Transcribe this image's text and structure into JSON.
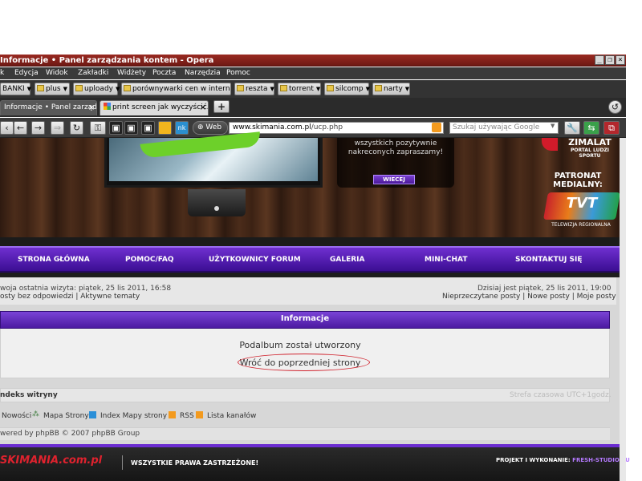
{
  "window": {
    "title": "Informacje • Panel zarządzania kontem - Opera",
    "controls": [
      "_",
      "❐",
      "×"
    ]
  },
  "menu": [
    "k",
    "Edycja",
    "Widok",
    "Zakładki",
    "Widżety",
    "Poczta",
    "Narzędzia",
    "Pomoc"
  ],
  "bookmarks": [
    "BANKI",
    "plus",
    "uploady",
    "porównywarki cen w internecie",
    "reszta",
    "torrent",
    "silcomp",
    "narty"
  ],
  "tabs": [
    {
      "label": "Informacje • Panel zarząd...",
      "close": "×"
    },
    {
      "label": "print screen jak wyczyścić...",
      "close": "×"
    }
  ],
  "tabbar": {
    "new_tab": "+"
  },
  "navbar": {
    "web_label": "Web",
    "url_host": "www.skimania.com.pl",
    "url_path": "/ucp.php",
    "search_placeholder": "Szukaj używając Google"
  },
  "banner": {
    "promo_text": "wszystkich pozytywnie nakreconych zapraszamy!",
    "more_button": "WIECEJ",
    "partner_name": "ZIMALAT",
    "partner_tagline": "PORTAL LUDZI SPORTU",
    "media_label": "PATRONAT MEDIALNY:",
    "tv_logo": "TVT",
    "tv_caption": "TELEWIZJA REGIONALNA"
  },
  "nav": [
    "STRONA GŁÓWNA",
    "POMOC/FAQ",
    "UŻYTKOWNICY FORUM",
    "GALERIA",
    "MINI-CHAT",
    "SKONTAKTUJ SIĘ"
  ],
  "info": {
    "last_visit": "woja ostatnia wizyta: piątek, 25 lis 2011, 16:58",
    "left_links": "osty bez odpowiedzi | Aktywne tematy",
    "today": "Dzisiaj jest piątek, 25 lis 2011, 19:00",
    "right_links": "Nieprzeczytane posty | Nowe posty | Moje posty"
  },
  "message": {
    "header": "Informacje",
    "line1": "Podalbum został utworzony",
    "line2": "Wróć do poprzedniej strony"
  },
  "footer": {
    "index": "ndeks witryny",
    "timezone": "Strefa czasowa UTC+1godz.",
    "links": [
      "Nowości",
      "Mapa Strony",
      "Index Mapy strony",
      "RSS",
      "Lista kanałów"
    ],
    "powered": "wered by phpBB © 2007 phpBB Group"
  },
  "site_footer": {
    "logo": "SKIMANIA.com.pl",
    "rights": "WSZYSTKIE PRAWA ZASTRZEŻONE!",
    "project_label": "PROJEKT I WYKONANIE:",
    "project_by": "FRESH-STUDIO.EU"
  },
  "colors": {
    "accent_purple": "#5a22b8",
    "title_bar_red": "#8a2018",
    "annotation_red": "#d0232e",
    "ski_red": "#e0222e"
  }
}
